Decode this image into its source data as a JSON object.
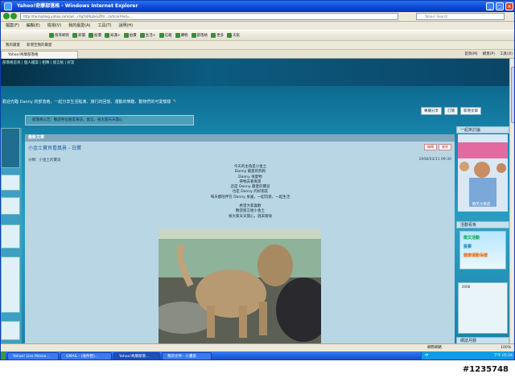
{
  "window": {
    "title": "Yahoo!奇摩部落格 - Windows Internet Explorer",
    "address": "http://tw.myblog.yahoo.com/jw!...rAgYj4AL8vGZPU.../article?mid=...",
    "search_placeholder": "Yahoo! Search"
  },
  "menu": [
    "檔案(F)",
    "編輯(E)",
    "檢視(V)",
    "我的最愛(A)",
    "工具(T)",
    "說明(H)"
  ],
  "toolbar": [
    "搜尋網頁",
    "新聞",
    "股價",
    "知識+",
    "拍賣",
    "生活+",
    "信箱",
    "購物",
    "部落格",
    "更多",
    "天氣"
  ],
  "favorites_bar": [
    "我的最愛",
    "新增至我的最愛"
  ],
  "tab": {
    "label": "Yahoo!奇摩部落格"
  },
  "command_bar": [
    "首頁(M)",
    "網頁(P)",
    "工具(O)"
  ],
  "blog": {
    "nav_links": "部落格首頁 | 個人檔案 | 相簿 | 留言板 | 好友",
    "description": "歡迎光臨 Danny 的部落格，一起分享生活點滴、旅行的回憶、運動的樂趣、動物們的可愛模樣",
    "notice": "部落格公告：歡迎各位朋友來訪、留言，祝大家天天開心",
    "buttons": [
      "專欄分享",
      "訂閱",
      "新增文章"
    ],
    "section_heading": "最新文章",
    "article": {
      "title": "小金土寶貝看風景 - 白鷺",
      "category": "分類：小金土的寶貝",
      "date": "2008/03/11 09:30",
      "action_buttons": [
        "編輯",
        "刪除"
      ],
      "poem": [
        "今天的主角是小金土",
        "Danny 最愛的狗狗",
        "Danny 很愛牠",
        "帶牠去看風景",
        "這是 Danny 最愛的寶貝",
        "也是 Danny 的好朋友",
        "每天都陪伴在 Danny 身邊，一起玩耍，一起生活",
        "希望大家喜歡",
        "歡迎留言給小金土",
        "祝大家天天開心，週末愉快"
      ]
    }
  },
  "sidebar_right": {
    "profile_heading": "一起來討論",
    "photo_caption": "歡笑大家庭",
    "events_heading": "活動看板",
    "promo": [
      "徵文活動",
      "投票",
      "健康運動保健"
    ],
    "calendar_year": "2008",
    "calendar_heading": "網誌月曆"
  },
  "statusbar": {
    "zone": "網際網路",
    "zoom": "100%"
  },
  "taskbar": {
    "tasks": [
      "Yahoo! Live Messe...",
      "GMAIL - (收件匣)...",
      "Yahoo!奇摩部落...",
      "我的文件 - 小畫家"
    ],
    "ime": "中",
    "clock": "下午 05:24"
  },
  "watermark": "#1235748"
}
